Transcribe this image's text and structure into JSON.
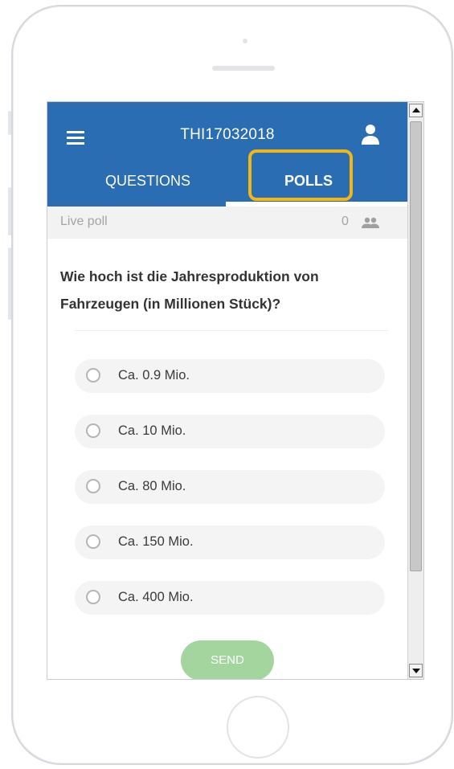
{
  "app": {
    "title": "THI17032018"
  },
  "tabs": {
    "questions_label": "QUESTIONS",
    "polls_label": "POLLS",
    "active": "POLLS"
  },
  "live_poll": {
    "label": "Live poll",
    "participant_count": "0"
  },
  "poll": {
    "question": "Wie hoch ist die Jahresproduktion von Fahrzeugen (in Millionen Stück)?",
    "options": [
      "Ca. 0.9 Mio.",
      "Ca. 10 Mio.",
      "Ca. 80 Mio.",
      "Ca. 150 Mio.",
      "Ca. 400 Mio."
    ],
    "send_label": "SEND"
  },
  "icons": {
    "menu": "hamburger-menu-icon",
    "user": "user-icon",
    "participants": "people-icon",
    "radio": "radio-unchecked-icon"
  },
  "colors": {
    "header": "#2a6db3",
    "highlight": "#f4b612",
    "send_button": "#a5d59f",
    "live_bar": "#f2f2f2"
  }
}
